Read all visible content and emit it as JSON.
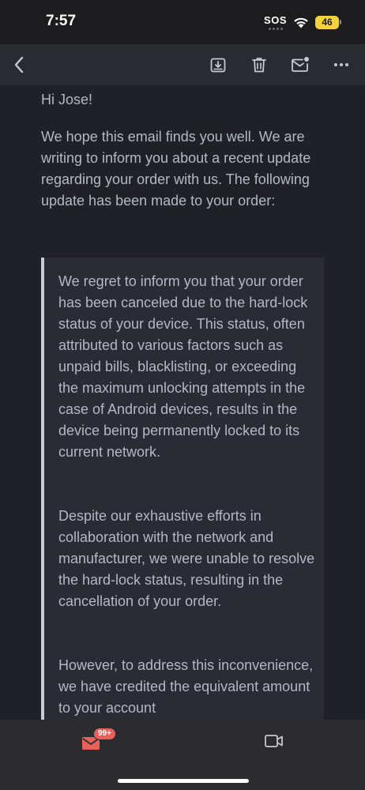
{
  "status_bar": {
    "time": "7:57",
    "sos": "SOS",
    "battery": "46"
  },
  "toolbar": {
    "icons": [
      "chevron-left-icon",
      "archive-icon",
      "trash-icon",
      "mark-unread-icon",
      "more-icon"
    ]
  },
  "email": {
    "greeting": "Hi Jose!",
    "intro": "We hope this email finds you well. We are writing to inform you about a recent update regarding your order with us. The following update has been made to your order:",
    "quote": [
      "We regret to inform you that your order has been canceled due to the hard-lock status of your device. This status, often attributed to various factors such as unpaid bills, blacklisting, or exceeding the maximum unlocking attempts in the case of Android devices, results in the device being permanently locked to its current network.",
      "Despite our exhaustive efforts in collaboration with the network and manufacturer, we were unable to resolve the hard-lock status, resulting in the cancellation of your order.",
      "However, to address this inconvenience, we have credited the equivalent amount to your account"
    ]
  },
  "tabbar": {
    "mail_badge": "99+"
  },
  "colors": {
    "badge": "#e8605a",
    "battery": "#f2d33f",
    "quote_border": "#c9ccd3"
  }
}
